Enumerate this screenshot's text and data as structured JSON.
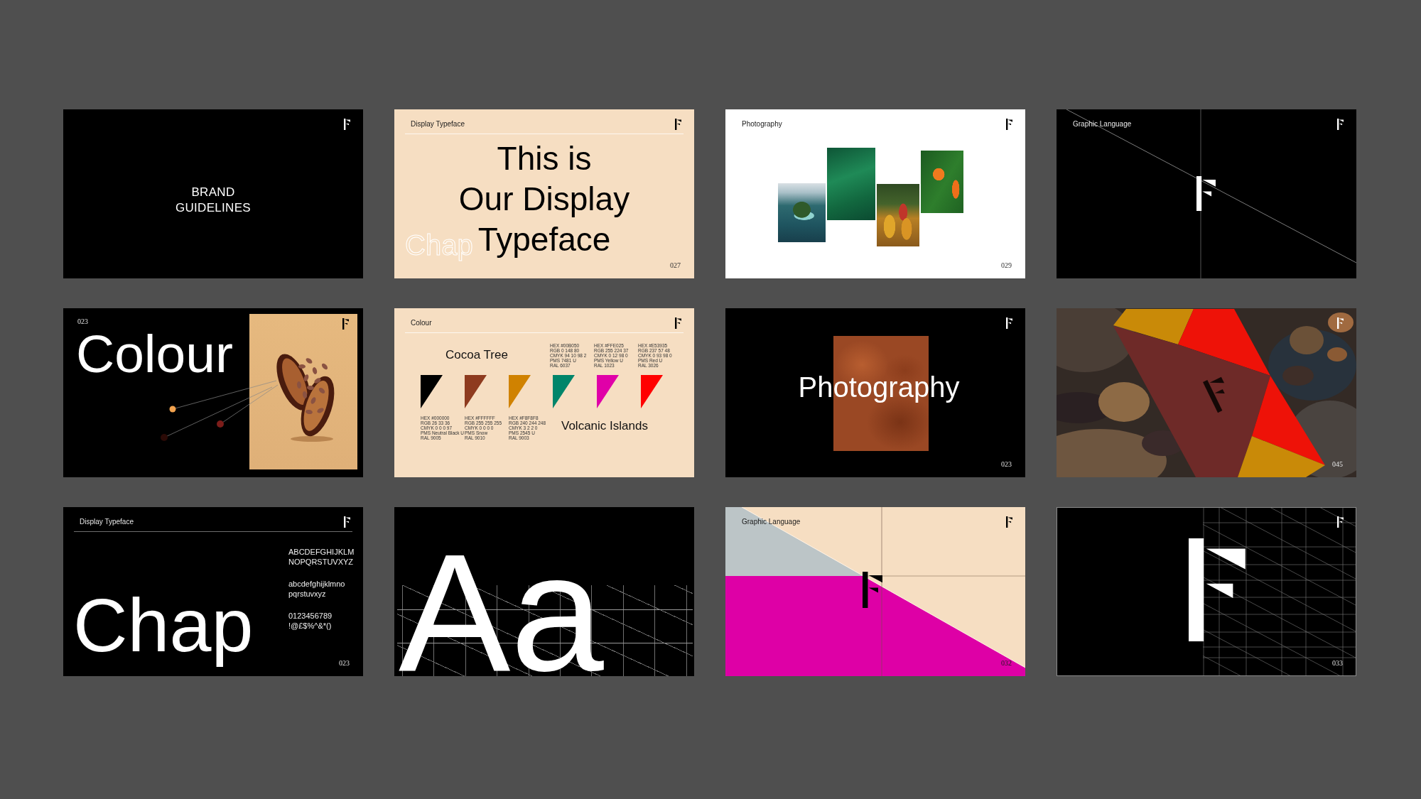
{
  "slides": [
    {
      "kind": "cover",
      "title": [
        "BRAND",
        "GUIDELINES"
      ]
    },
    {
      "kind": "statement",
      "header": "Display Typeface",
      "outline_text": "Chap",
      "headline": [
        "This is",
        "Our Display",
        "Typeface"
      ],
      "page": "027"
    },
    {
      "kind": "collage",
      "header": "Photography",
      "page": "029"
    },
    {
      "kind": "mark_lines",
      "header": "Graphic Language"
    },
    {
      "kind": "colour_intro",
      "page": "023",
      "title": "Colour",
      "dots": [
        {
          "color": "#f2a24e"
        },
        {
          "color": "#7c1d1a"
        },
        {
          "color": "#2b0a06"
        }
      ]
    },
    {
      "kind": "palette",
      "header": "Colour",
      "groups": [
        {
          "name": "Cocoa Tree",
          "swatches": [
            {
              "color": "#000000",
              "spec": [
                "HEX #000000",
                "RGB 26 33 36",
                "CMYK 0 0 0 97",
                "PMS Neutral Black U",
                "RAL 9005"
              ]
            },
            {
              "color": "#8e3b1f",
              "spec": [
                "HEX #FFFFFF",
                "RGB 255 255 255",
                "CMYK 0 0 0 0",
                "PMS Snow",
                "RAL 9010"
              ]
            },
            {
              "color": "#d08200",
              "spec": [
                "HEX #F8F8F8",
                "RGB 240 244 248",
                "CMYK 3 2 2 0",
                "PMS 2545 U",
                "RAL 9003"
              ]
            }
          ]
        },
        {
          "name": "Volcanic Islands",
          "swatches": [
            {
              "color": "#00856a",
              "spec": [
                "HEX #00B050",
                "RGB 0 148 80",
                "CMYK 94 10 98 2",
                "PMS 7481 U",
                "RAL 6037"
              ]
            },
            {
              "color": "#e000a8",
              "spec": [
                "HEX #FFE025",
                "RGB 255 224 37",
                "CMYK 0 12 98 0",
                "PMS Yellow U",
                "RAL 1023"
              ]
            },
            {
              "color": "#ff0000",
              "spec": [
                "HEX #E53935",
                "RGB 237 57 48",
                "CMYK 0 93 98 0",
                "PMS Red U",
                "RAL 3026"
              ]
            }
          ]
        }
      ]
    },
    {
      "kind": "photo_title",
      "title": "Photography",
      "page": "023"
    },
    {
      "kind": "rock_photo",
      "page": "045"
    },
    {
      "kind": "specimen",
      "header": "Display Typeface",
      "display": "Chap",
      "glyph_sets": [
        [
          "ABCDEFGHIJKLM",
          "NOPQRSTUVXYZ"
        ],
        [
          "abcdefghijklmno",
          "pqrstuvxyz"
        ],
        [
          "0123456789",
          "!@£$%^&*()"
        ]
      ],
      "page": "023"
    },
    {
      "kind": "glyph_grid",
      "display": "Aa"
    },
    {
      "kind": "colour_blocks",
      "header": "Graphic Language",
      "page": "032"
    },
    {
      "kind": "mark_grid",
      "page": "033"
    }
  ]
}
